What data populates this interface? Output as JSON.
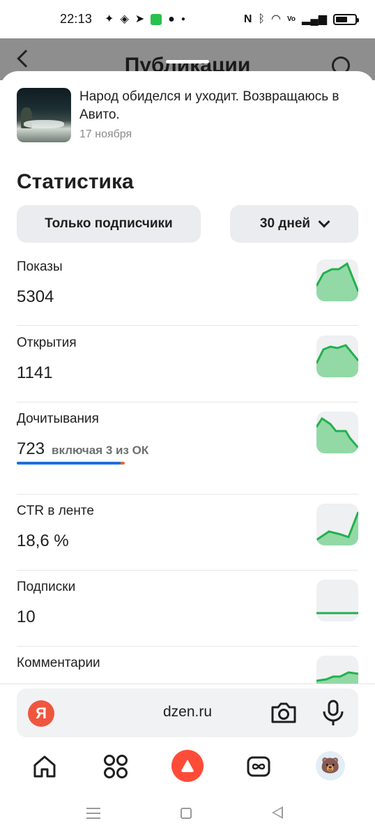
{
  "status_bar": {
    "time": "22:13",
    "left_icons": [
      "sparkle-icon",
      "app-icon",
      "telegram-icon",
      "green-app-icon",
      "person-icon",
      "dot-icon"
    ],
    "right_icons": [
      "nfc-icon",
      "bluetooth-icon",
      "wifi-icon",
      "volte-icon",
      "signal-icon",
      "battery-icon"
    ]
  },
  "background_page": {
    "title": "Публикации"
  },
  "article": {
    "title": "Народ обиделся и уходит. Возвращаюсь в Авито.",
    "date": "17 ноября"
  },
  "stats": {
    "title": "Статистика",
    "filter_label": "Только подписчики",
    "period_label": "30 дней",
    "metrics": [
      {
        "label": "Показы",
        "value": "5304"
      },
      {
        "label": "Открытия",
        "value": "1141"
      },
      {
        "label": "Дочитывания",
        "value": "723",
        "extra": "включая 3 из ОК",
        "progress": 0.97
      },
      {
        "label": "CTR в ленте",
        "value": "18,6 %"
      },
      {
        "label": "Подписки",
        "value": "10"
      },
      {
        "label": "Комментарии",
        "value": ""
      }
    ]
  },
  "browser": {
    "badge": "Я",
    "url": "dzen.ru"
  },
  "bottom_nav": {
    "avatar_emoji": "🐻"
  },
  "colors": {
    "accent_green": "#22b14c",
    "spark_fill": "#92d9a6",
    "progress_blue": "#1e6fd9",
    "progress_orange": "#f0622b",
    "yandex_red": "#f0563e",
    "alice_red": "#ff4c38"
  }
}
